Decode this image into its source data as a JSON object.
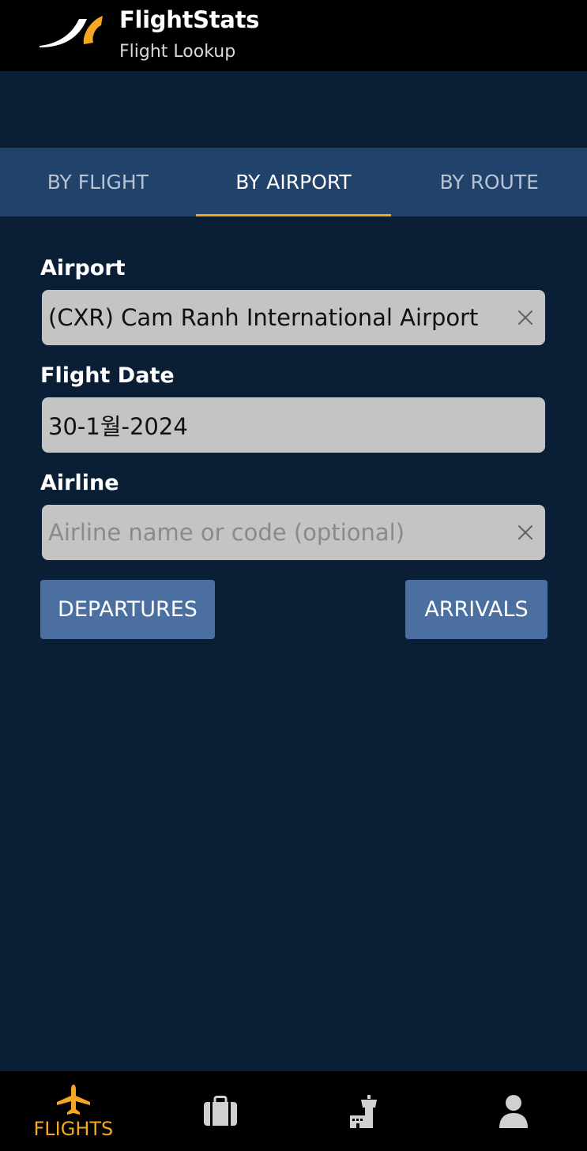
{
  "header": {
    "title": "FlightStats",
    "subtitle": "Flight Lookup"
  },
  "tabs": [
    {
      "label": "BY FLIGHT",
      "active": false
    },
    {
      "label": "BY AIRPORT",
      "active": true
    },
    {
      "label": "BY ROUTE",
      "active": false
    }
  ],
  "form": {
    "airport_label": "Airport",
    "airport_value": "(CXR) Cam Ranh International Airport",
    "date_label": "Flight Date",
    "date_value": "30-1월-2024",
    "airline_label": "Airline",
    "airline_placeholder": "Airline name or code (optional)"
  },
  "buttons": {
    "departures": "DEPARTURES",
    "arrivals": "ARRIVALS"
  },
  "bottom_nav": [
    {
      "label": "FLIGHTS",
      "icon": "airplane-icon",
      "active": true
    },
    {
      "label": "",
      "icon": "briefcase-icon",
      "active": false
    },
    {
      "label": "",
      "icon": "airport-tower-icon",
      "active": false
    },
    {
      "label": "",
      "icon": "profile-icon",
      "active": false
    }
  ],
  "colors": {
    "background": "#0a1e36",
    "tab_bar": "#21426a",
    "accent": "#f5a623",
    "button": "#4a6fa0",
    "field": "#c4c4c4"
  }
}
